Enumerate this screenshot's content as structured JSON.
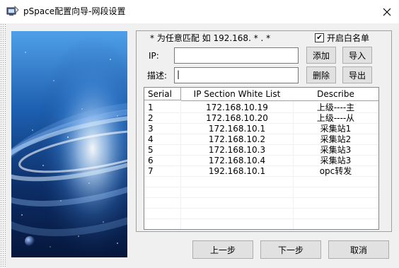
{
  "window": {
    "title": "pSpace配置向导-网段设置",
    "close_symbol": "✕",
    "icon": "app-icon"
  },
  "form": {
    "hint": "* 为任意匹配  如 192.168. * . *",
    "whitelist_label": "开启白名单",
    "whitelist_checked": true,
    "check_mark": "✔",
    "ip_label": "IP:",
    "ip_value": "",
    "desc_label": "描述:",
    "desc_value": "|",
    "add_button": "添加",
    "import_button": "导入",
    "delete_button": "删除",
    "export_button": "导出"
  },
  "table": {
    "columns": [
      "Serial",
      "IP Section White List",
      "Describe"
    ],
    "rows": [
      {
        "serial": "1",
        "ip": "172.168.10.19",
        "desc": "上级----主"
      },
      {
        "serial": "2",
        "ip": "172.168.10.20",
        "desc": "上级----从"
      },
      {
        "serial": "3",
        "ip": "172.168.10.1",
        "desc": "采集站1"
      },
      {
        "serial": "4",
        "ip": "172.168.10.2",
        "desc": "采集站2"
      },
      {
        "serial": "5",
        "ip": "172.168.10.3",
        "desc": "采集站3"
      },
      {
        "serial": "6",
        "ip": "172.168.10.4",
        "desc": "采集站3"
      },
      {
        "serial": "7",
        "ip": "192.168.10.1",
        "desc": "opc转发"
      }
    ]
  },
  "footer": {
    "prev_button": "上一步",
    "next_button": "下一步",
    "cancel_button": "取消"
  }
}
